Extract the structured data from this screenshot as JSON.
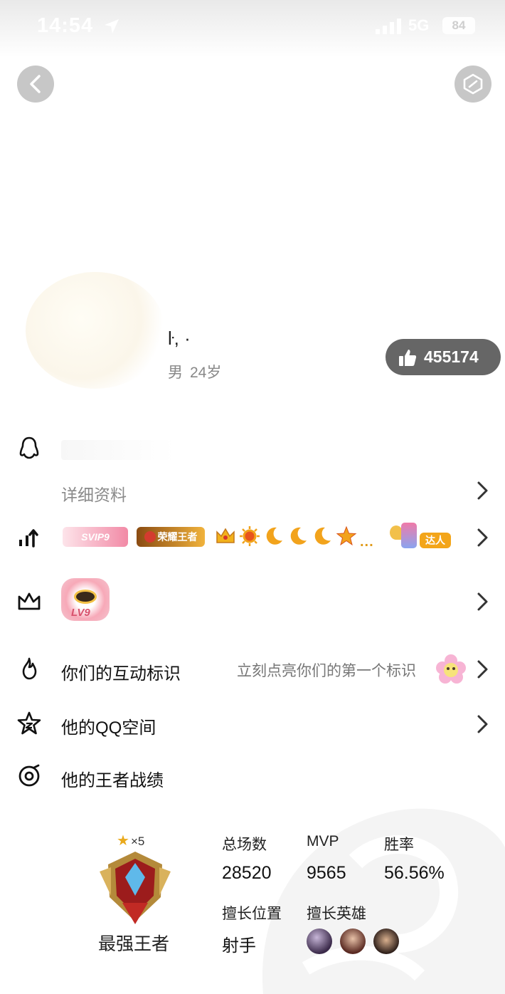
{
  "status_bar": {
    "time": "14:54",
    "network": "5G",
    "battery": "84"
  },
  "profile": {
    "nickname": "ŀ, ·",
    "gender": "男",
    "age": "24岁",
    "likes": "455174"
  },
  "rows": {
    "detail_label": "详细资料",
    "interaction_label": "你们的互动标识",
    "interaction_hint": "立刻点亮你们的第一个标识",
    "qzone_label": "他的QQ空间",
    "game_label": "他的王者战绩"
  },
  "badges": {
    "svip": "SVIP9",
    "glory": "荣耀王者",
    "ellipsis": "...",
    "daren": "达人",
    "lv": "LV9"
  },
  "game": {
    "stars": "×5",
    "rank": "最强王者",
    "total_label": "总场数",
    "total_value": "28520",
    "mvp_label": "MVP",
    "mvp_value": "9565",
    "winrate_label": "胜率",
    "winrate_value": "56.56%",
    "position_label": "擅长位置",
    "position_value": "射手",
    "heroes_label": "擅长英雄"
  },
  "icons": [
    "back-arrow-icon",
    "shield-icon",
    "thumbs-up-icon",
    "penguin-icon",
    "level-up-icon",
    "crown-icon",
    "flame-icon",
    "star-icon",
    "game-target-icon",
    "chevron-right-icon"
  ]
}
